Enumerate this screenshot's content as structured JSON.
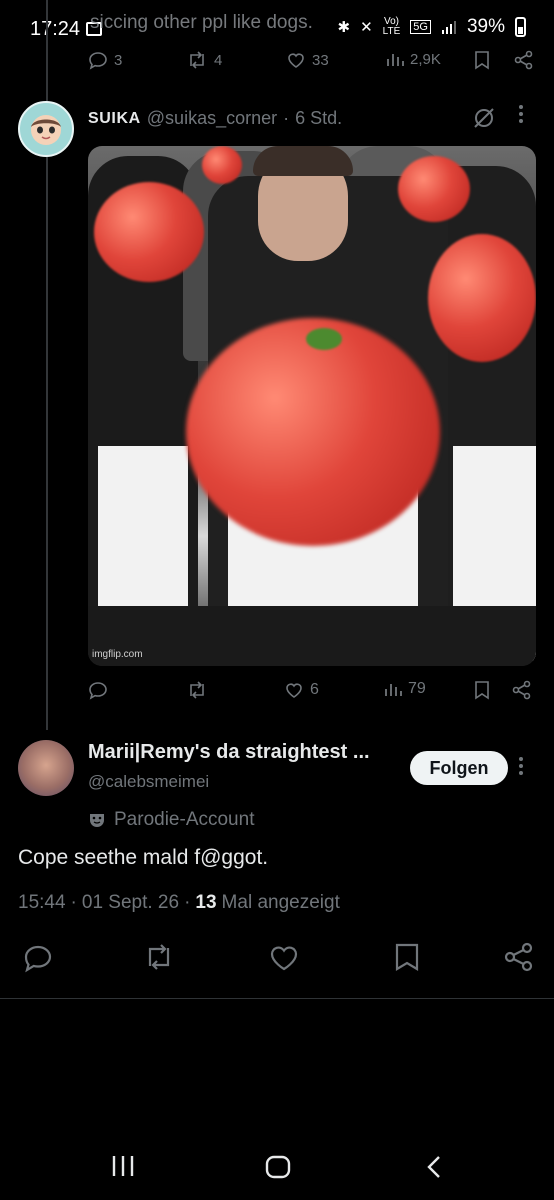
{
  "status_bar": {
    "time": "17:24",
    "net_label": "5G",
    "volte_label": "LTE",
    "battery": "39%",
    "battery_level": 0.39
  },
  "previous_tweet": {
    "text_fragment": "siccing other ppl like dogs.",
    "replies": "3",
    "reposts": "4",
    "likes": "33",
    "views": "2,9K"
  },
  "quoted_tweet": {
    "display_name": "SUIKA",
    "handle": "@suikas_corner",
    "time": "6 Std.",
    "image_watermark": "imgflip.com",
    "likes": "6",
    "views": "79"
  },
  "main_tweet": {
    "display_name": "Marii|Remy's da straightest ...",
    "handle": "@calebsmeimei",
    "follow_label": "Folgen",
    "account_label": "Parodie-Account",
    "text": "Cope seethe mald f@ggot.",
    "time": "15:44",
    "date": "01 Sept. 26",
    "view_count": "13",
    "view_label": "Mal angezeigt"
  },
  "colors": {
    "background": "#000000",
    "text_primary": "#e7e9ea",
    "text_muted": "#71767b",
    "follow_bg": "#eff3f4"
  }
}
